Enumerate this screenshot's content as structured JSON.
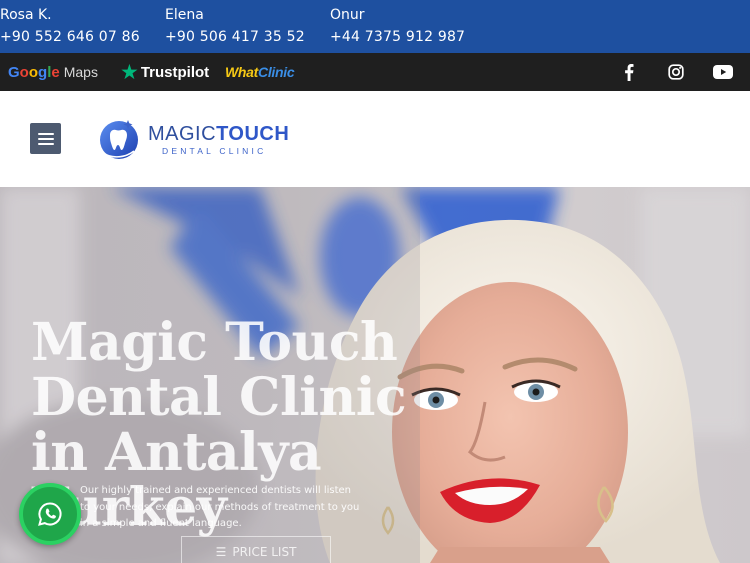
{
  "contacts": [
    {
      "name": "Rosa K.",
      "phone": "+90 552 646 07 86"
    },
    {
      "name": "Elena",
      "phone": "+90 506 417 35 52"
    },
    {
      "name": "Onur",
      "phone": "+44 7375 912 987"
    }
  ],
  "reviews": {
    "google": {
      "letters": [
        "G",
        "o",
        "o",
        "g",
        "l",
        "e"
      ],
      "suffix": "Maps"
    },
    "trustpilot": "Trustpilot",
    "whatclinic": {
      "part1": "What",
      "part2": "Clinic"
    }
  },
  "social": [
    "facebook-icon",
    "instagram-icon",
    "youtube-icon"
  ],
  "logo": {
    "name_regular": "MAGIC",
    "name_bold": "TOUCH",
    "subtitle": "DENTAL CLINIC"
  },
  "hero": {
    "title": "Magic Touch\nDental Clinic\nin Antalya\nTurkey",
    "description": "Our highly trained and experienced dentists will listen to your needs, explain our methods of treatment to you in a simple and fluent language.",
    "price_button": "PRICE LIST"
  },
  "colors": {
    "contact_bar": "#1e50a0",
    "review_bar": "#1f1f1f",
    "whatsapp": "#1fa64a",
    "trustpilot": "#00b67a"
  }
}
